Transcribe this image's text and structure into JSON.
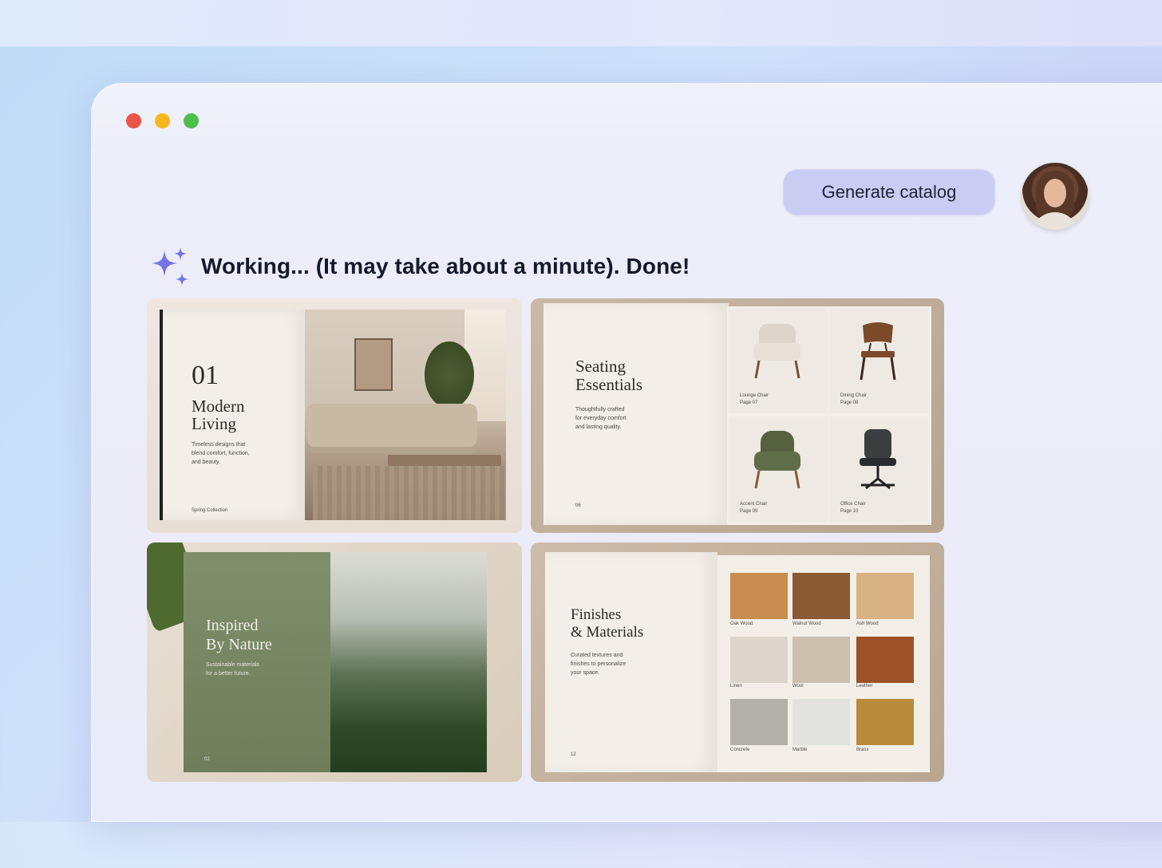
{
  "header": {
    "generate_button_label": "Generate catalog"
  },
  "status": {
    "text": "Working...  (It may take about a minute). Done!"
  },
  "catalog": {
    "modern_living": {
      "number": "01",
      "title_line1": "Modern",
      "title_line2": "Living",
      "desc_line1": "Timeless designs that",
      "desc_line2": "blend comfort, function,",
      "desc_line3": "and beauty.",
      "collection": "Spring Collection"
    },
    "seating": {
      "title_line1": "Seating",
      "title_line2": "Essentials",
      "desc_line1": "Thoughtfully crafted",
      "desc_line2": "for everyday comfort",
      "desc_line3": "and lasting quality.",
      "page": "06",
      "items": [
        {
          "name": "Lounge Chair",
          "page": "Page 07"
        },
        {
          "name": "Dining Chair",
          "page": "Page 08"
        },
        {
          "name": "Accent Chair",
          "page": "Page 09"
        },
        {
          "name": "Office Chair",
          "page": "Page 10"
        }
      ]
    },
    "nature": {
      "title_line1": "Inspired",
      "title_line2": "By Nature",
      "desc_line1": "Sustainable materials",
      "desc_line2": "for a better future.",
      "page": "02"
    },
    "finishes": {
      "title_line1": "Finishes",
      "title_line2": "& Materials",
      "desc_line1": "Curated textures and",
      "desc_line2": "finishes to personalize",
      "desc_line3": "your space.",
      "page": "12",
      "swatches": [
        {
          "name": "Oak Wood",
          "color": "#c98d4f"
        },
        {
          "name": "Walnut Wood",
          "color": "#8a5a35"
        },
        {
          "name": "Ash Wood",
          "color": "#d7b283"
        },
        {
          "name": "Linen",
          "color": "#dcd5cb"
        },
        {
          "name": "Wool",
          "color": "#cbbfae"
        },
        {
          "name": "Leather",
          "color": "#9c5226"
        },
        {
          "name": "Concrete",
          "color": "#b3b0aa"
        },
        {
          "name": "Marble",
          "color": "#e2e2df"
        },
        {
          "name": "Brass",
          "color": "#b88a3a"
        }
      ]
    }
  }
}
